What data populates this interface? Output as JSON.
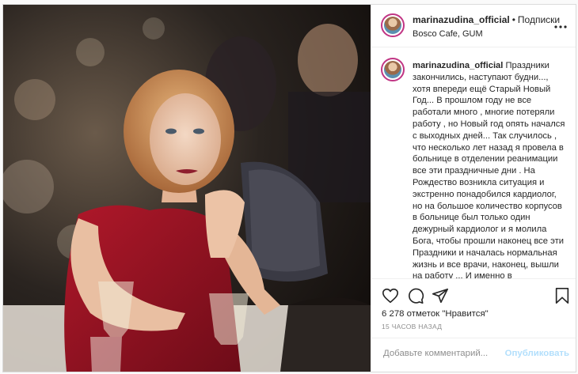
{
  "post": {
    "username": "marinazudina_official",
    "separator": "•",
    "follow_label": "Подписки",
    "location": "Bosco Cafe, GUM",
    "more_icon": "more-horizontal-icon"
  },
  "caption": {
    "username": "marinazudina_official",
    "text": "Праздники закончились, наступают будни..., хотя впереди ещё Старый Новый Год... В прошлом году не все работали много , многие потеряли работу , но Новый год опять начался с выходных дней... Так случилось , что несколько лет назад я провела в больнице в отделении реанимации все эти праздничные дни . На Рождество возникла ситуация и экстренно понадобился кардиолог, но на большое количество корпусов в больнице был только один дежурный кардиолог и я молила Бога, чтобы прошли наконец все эти Праздники и началась нормальная жизнь и все врачи, наконец, вышли на работу ... И именно в Праздничные дни люди"
  },
  "actions": {
    "like_icon": "heart-icon",
    "comment_icon": "comment-icon",
    "share_icon": "share-icon",
    "save_icon": "bookmark-icon"
  },
  "likes_text": "6 278 отметок \"Нравится\"",
  "timestamp": "15 ЧАСОВ НАЗАД",
  "comment": {
    "placeholder": "Добавьте комментарий...",
    "publish_label": "Опубликовать"
  },
  "colors": {
    "publish_disabled": "#b2dffc",
    "secondary_text": "#8e8e8e",
    "border": "#dbdbdb"
  }
}
